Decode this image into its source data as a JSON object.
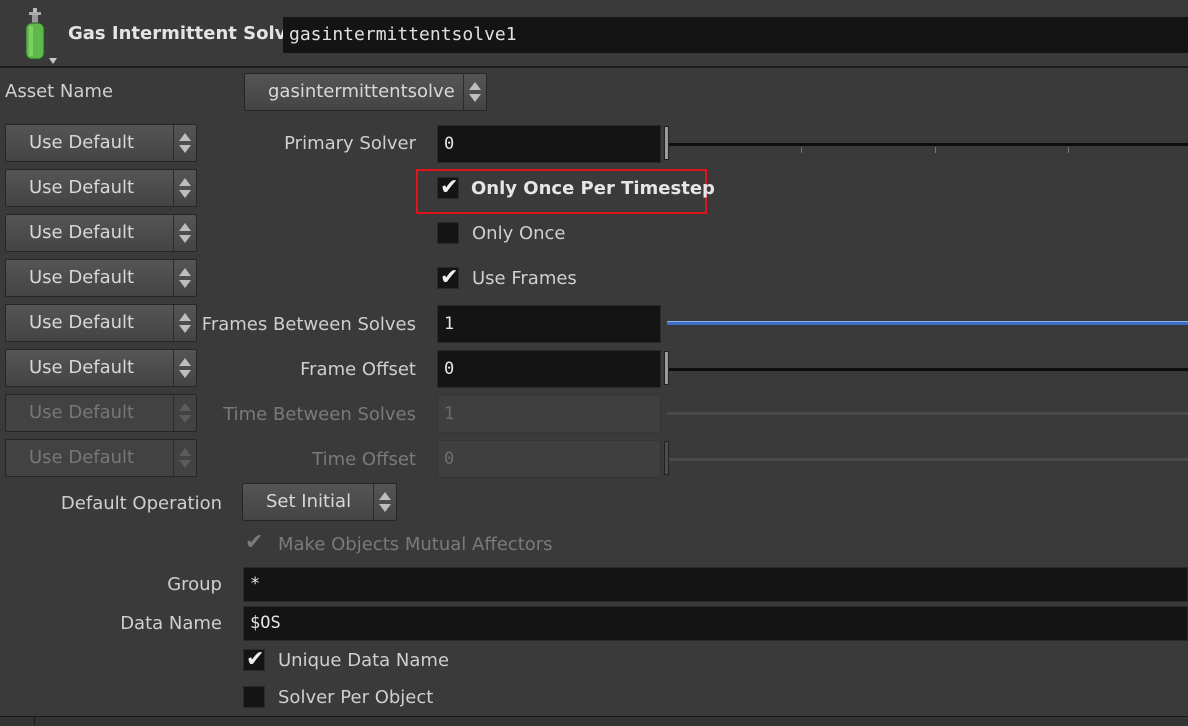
{
  "header": {
    "node_type": "Gas Intermittent Solve",
    "node_name": "gasintermittentsolve1",
    "icon": "gas-cylinder-icon"
  },
  "asset": {
    "label": "Asset Name",
    "value": "gasintermittentsolve"
  },
  "default_button_label": "Use Default",
  "params": {
    "primary_solver": {
      "label": "Primary Solver",
      "value": "0"
    },
    "only_once_per_timestep": {
      "label": "Only Once Per Timestep",
      "checked": true
    },
    "only_once": {
      "label": "Only Once",
      "checked": false
    },
    "use_frames": {
      "label": "Use Frames",
      "checked": true
    },
    "frames_between_solves": {
      "label": "Frames Between Solves",
      "value": "1"
    },
    "frame_offset": {
      "label": "Frame Offset",
      "value": "0"
    },
    "time_between_solves": {
      "label": "Time Between Solves",
      "value": "1"
    },
    "time_offset": {
      "label": "Time Offset",
      "value": "0"
    },
    "default_operation": {
      "label": "Default Operation",
      "value": "Set Initial"
    },
    "make_objects_mutual_affectors": {
      "label": "Make Objects Mutual Affectors",
      "checked": true
    },
    "group": {
      "label": "Group",
      "value": "*"
    },
    "data_name": {
      "label": "Data Name",
      "value": "$OS"
    },
    "unique_data_name": {
      "label": "Unique Data Name",
      "checked": true
    },
    "solver_per_object": {
      "label": "Solver Per Object",
      "checked": false
    }
  },
  "colors": {
    "highlight": "#e0141c",
    "slider_accent": "#3c6fc4",
    "background": "#3a3a3a"
  }
}
